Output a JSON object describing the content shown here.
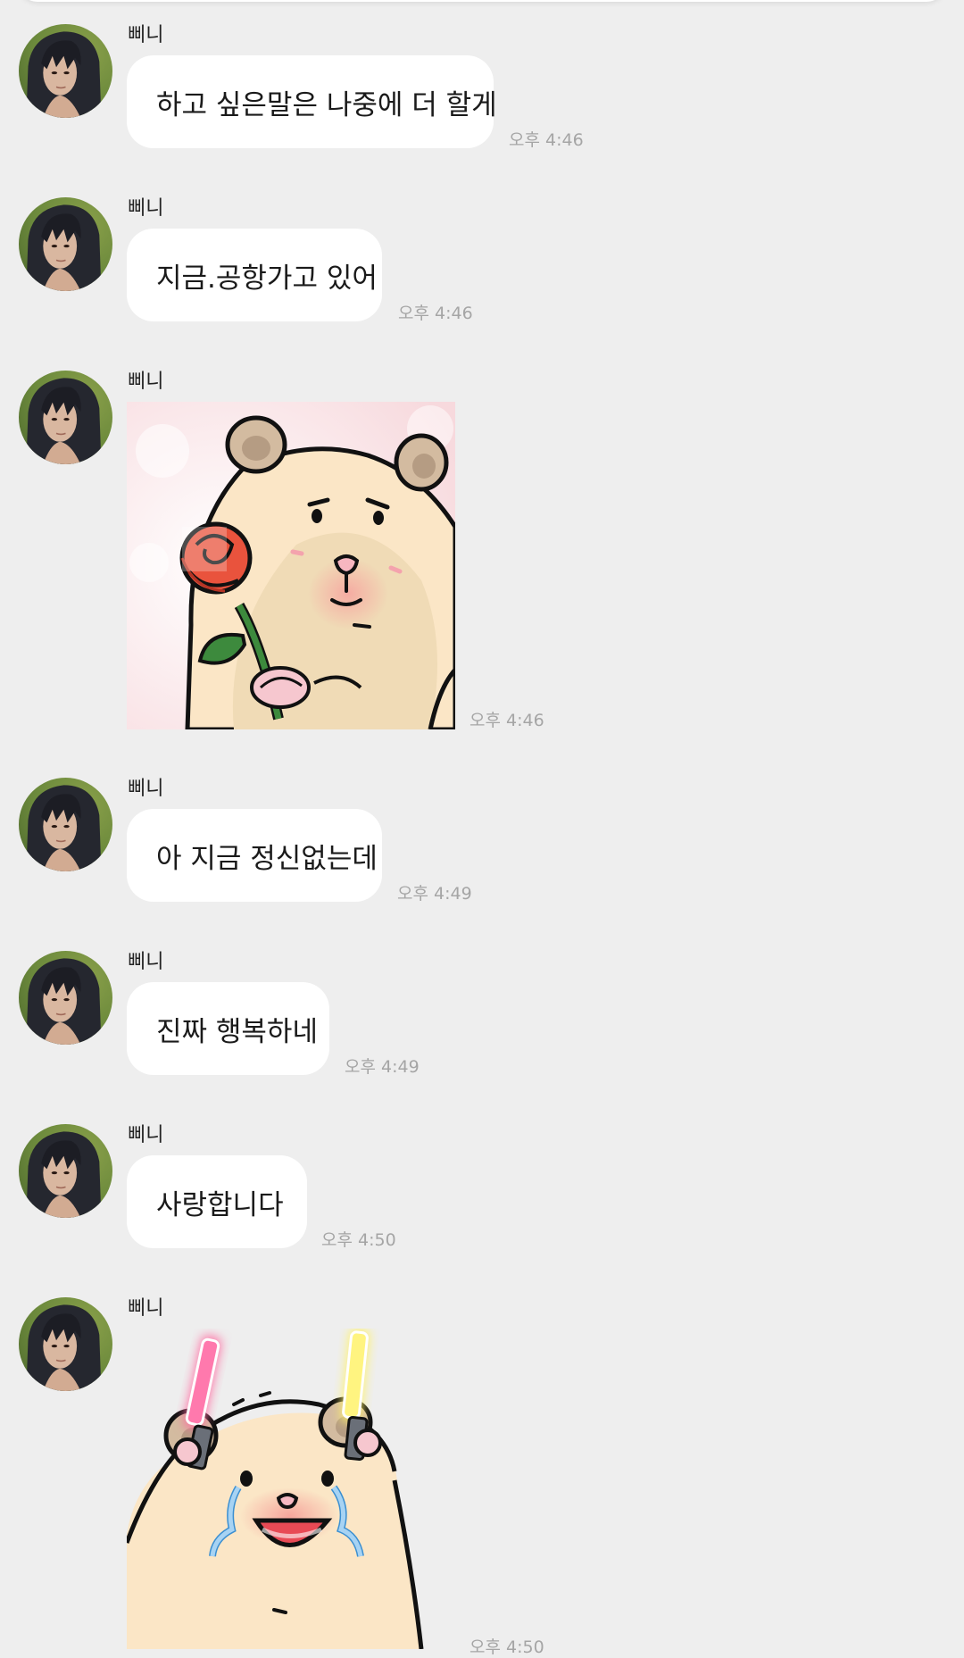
{
  "top_card": {},
  "messages": [
    {
      "sender": "삐니",
      "text": "하고 싶은말은 나중에 더 할게",
      "time": "오후 4:46"
    },
    {
      "sender": "삐니",
      "text": "지금.공항가고 있어",
      "time": "오후 4:46"
    },
    {
      "sender": "삐니",
      "sticker": "hamster-rose-sticker",
      "time": "오후 4:46"
    },
    {
      "sender": "삐니",
      "text": "아 지금 정신없는데",
      "time": "오후 4:49"
    },
    {
      "sender": "삐니",
      "text": "진짜 행복하네",
      "time": "오후 4:49"
    },
    {
      "sender": "삐니",
      "text": "사랑합니다",
      "time": "오후 4:50"
    },
    {
      "sender": "삐니",
      "sticker": "hamster-lightsticks-crying-sticker",
      "time": "오후 4:50"
    }
  ],
  "colors": {
    "background": "#eeeeee",
    "bubble": "#ffffff",
    "time_text": "#a5a5a5",
    "sender_text": "#222222"
  }
}
